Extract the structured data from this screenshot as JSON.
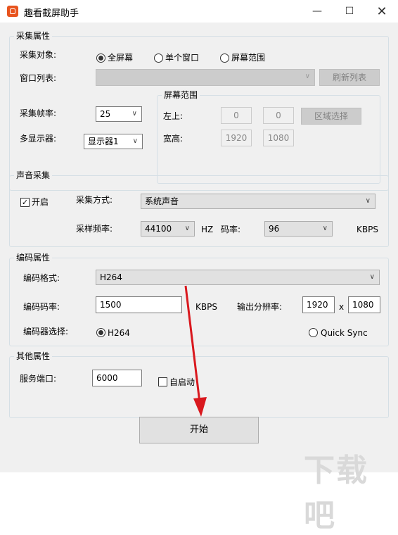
{
  "window": {
    "title": "趣看截屏助手"
  },
  "capture": {
    "group_label": "采集属性",
    "target_label": "采集对象:",
    "target_options": [
      "全屏幕",
      "单个窗口",
      "屏幕范围"
    ],
    "target_selected": 0,
    "window_list_label": "窗口列表:",
    "window_list_value": "",
    "refresh_button": "刷新列表",
    "framerate_label": "采集帧率:",
    "framerate_value": "25",
    "monitor_label": "多显示器:",
    "monitor_value": "显示器1",
    "region": {
      "group_label": "屏幕范围",
      "topleft_label": "左上:",
      "x": "0",
      "y": "0",
      "select_button": "区域选择",
      "size_label": "宽高:",
      "width": "1920",
      "height": "1080"
    }
  },
  "audio": {
    "group_label": "声音采集",
    "enable_label": "开启",
    "enabled": true,
    "method_label": "采集方式:",
    "method_value": "系统声音",
    "samplerate_label": "采样频率:",
    "samplerate_value": "44100",
    "hz_unit": "HZ",
    "bitrate_label": "码率:",
    "bitrate_value": "96",
    "kbps_unit": "KBPS"
  },
  "encode": {
    "group_label": "编码属性",
    "format_label": "编码格式:",
    "format_value": "H264",
    "bitrate_label": "编码码率:",
    "bitrate_value": "1500",
    "kbps_unit": "KBPS",
    "resolution_label": "输出分辨率:",
    "res_width": "1920",
    "res_x": "x",
    "res_height": "1080",
    "encoder_label": "编码器选择:",
    "encoder_options": [
      "H264",
      "Quick Sync"
    ],
    "encoder_selected": 0
  },
  "other": {
    "group_label": "其他属性",
    "port_label": "服务端口:",
    "port_value": "6000",
    "autostart_label": "自启动",
    "autostart": false
  },
  "start_button": "开始",
  "colors": {
    "annotation_arrow": "#d9181e",
    "app_icon": "#e8541e"
  },
  "icons": {
    "app": "app-logo-icon",
    "minimize": "minimize-icon",
    "maximize": "maximize-icon",
    "close": "close-icon"
  },
  "watermark": "下载吧"
}
